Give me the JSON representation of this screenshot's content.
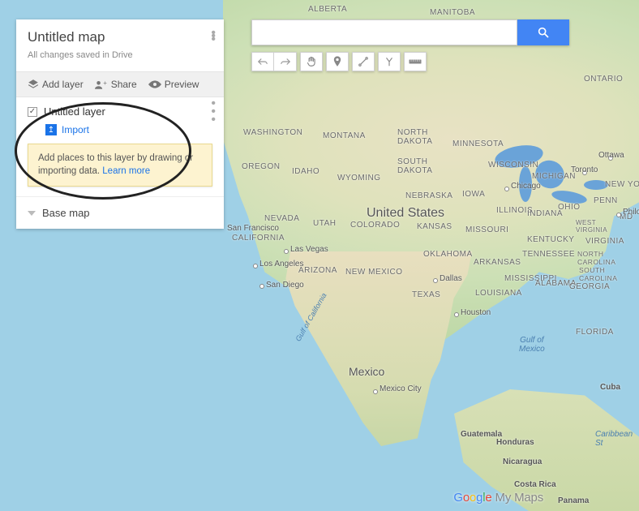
{
  "panel": {
    "title": "Untitled map",
    "save_status": "All changes saved in Drive",
    "toolbar": {
      "add_layer": "Add layer",
      "share": "Share",
      "preview": "Preview"
    },
    "layer": {
      "name": "Untitled layer",
      "checked": true,
      "import_label": "Import"
    },
    "tip": {
      "text": "Add places to this layer by drawing or importing data.",
      "learn_more": "Learn more"
    },
    "basemap_label": "Base map"
  },
  "search": {
    "placeholder": ""
  },
  "tools": {
    "undo": "↶",
    "redo": "↷",
    "pan": "✋",
    "marker": "📍",
    "line": "↗",
    "route": "⑂",
    "measure": "⟷"
  },
  "map": {
    "country_main": "United States",
    "country_mx": "Mexico",
    "gulf_mx": "Gulf of\nMexico",
    "gulf_ca": "Gulf of California",
    "caribbean": "Caribbean St",
    "provinces": [
      "ALBERTA",
      "MANITOBA",
      "ONTARIO"
    ],
    "states": [
      "WASHINGTON",
      "MONTANA",
      "NORTH DAKOTA",
      "MINNESOTA",
      "WISCONSIN",
      "MICHIGAN",
      "OREGON",
      "IDAHO",
      "WYOMING",
      "SOUTH DAKOTA",
      "IOWA",
      "NEBRASKA",
      "ILLINOIS",
      "INDIANA",
      "OHIO",
      "PENN",
      "NEVADA",
      "UTAH",
      "COLORADO",
      "KANSAS",
      "MISSOURI",
      "KENTUCKY",
      "WEST VIRGINIA",
      "VIRGINIA",
      "CALIFORNIA",
      "ARIZONA",
      "NEW MEXICO",
      "OKLAHOMA",
      "ARKANSAS",
      "TENNESSEE",
      "NORTH CAROLINA",
      "SOUTH CAROLINA",
      "TEXAS",
      "LOUISIANA",
      "MISSISSIPPI",
      "ALABAMA",
      "GEORGIA",
      "FLORIDA",
      "NEW YORK",
      "MD"
    ],
    "ca_countries": [
      "Cuba",
      "Guatemala",
      "Honduras",
      "Nicaragua",
      "Costa Rica",
      "Panama"
    ],
    "cities": [
      {
        "name": "San Francisco",
        "dot": false
      },
      {
        "name": "Los Angeles",
        "dot": true
      },
      {
        "name": "Las Vegas",
        "dot": true
      },
      {
        "name": "San Diego",
        "dot": true
      },
      {
        "name": "Dallas",
        "dot": true
      },
      {
        "name": "Houston",
        "dot": true
      },
      {
        "name": "Chicago",
        "dot": true
      },
      {
        "name": "Toronto",
        "dot": true
      },
      {
        "name": "Ottawa",
        "dot": true
      },
      {
        "name": "Philo",
        "dot": true
      },
      {
        "name": "Mexico City",
        "dot": true
      }
    ]
  },
  "attribution": {
    "google": "Google",
    "mymaps": " My Maps"
  }
}
